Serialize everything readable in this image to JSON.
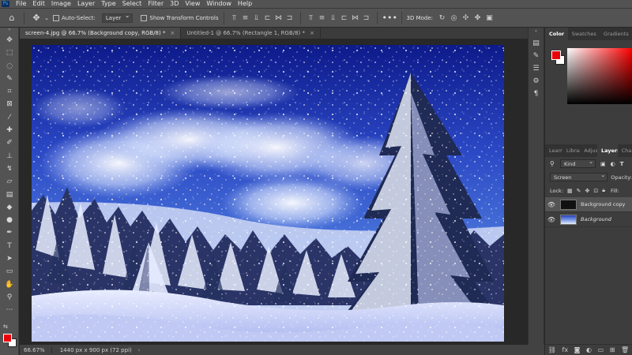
{
  "app": {
    "logo": "Ps"
  },
  "menu": [
    "File",
    "Edit",
    "Image",
    "Layer",
    "Type",
    "Select",
    "Filter",
    "3D",
    "View",
    "Window",
    "Help"
  ],
  "options": {
    "home_icon": "home-icon",
    "move_icon": "move-icon",
    "auto_select_label": "Auto-Select:",
    "auto_select_value": "Layer",
    "show_transform_label": "Show Transform Controls",
    "three_d_label": "3D Mode:"
  },
  "tabs": [
    {
      "label": "screen-4.jpg @ 66.7% (Background copy, RGB/8) *",
      "close": "×",
      "active": true
    },
    {
      "label": "Untitled-1 @ 66.7% (Rectangle 1, RGB/8) *",
      "close": "×",
      "active": false
    }
  ],
  "status": {
    "zoom": "66.67%",
    "dims": "1440 px x 900 px (72 ppi)",
    "chevron": "›"
  },
  "color_panel": {
    "tabs": [
      "Color",
      "Swatches",
      "Gradients"
    ],
    "foreground": "#e8000b",
    "background": "#ffffff"
  },
  "layers_panel": {
    "tabs": [
      "Learn",
      "Librar",
      "Adjus",
      "Layers",
      "Cha"
    ],
    "kind_label": "Kind",
    "blend_mode": "Screen",
    "opacity_label": "Opacity:",
    "lock_label": "Lock:",
    "fill_label": "Fill:",
    "layers": [
      {
        "name": "Background copy",
        "selected": true,
        "visible": true
      },
      {
        "name": "Background",
        "selected": false,
        "visible": true
      }
    ],
    "footer_fx": "fx"
  }
}
